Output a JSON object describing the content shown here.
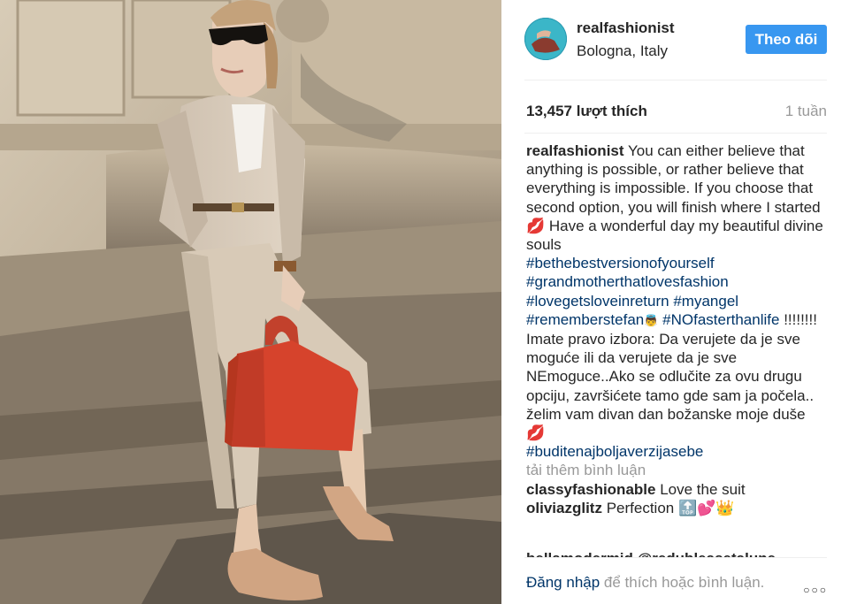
{
  "post": {
    "username": "realfashionist",
    "location": "Bologna, Italy",
    "follow_label": "Theo dõi",
    "likes": "13,457 lượt thích",
    "time": "1 tuần"
  },
  "caption": {
    "username": "realfashionist",
    "text_1": "You can either believe that anything is possible, or rather believe that everything is impossible. If you choose that second option, you will finish where I started 💋 Have a wonderful day my beautiful divine souls",
    "hashtags_1": [
      "#bethebestversionofyourself",
      "#grandmotherthatlovesfashion",
      "#lovegetsloveinreturn",
      "#myangel",
      "#rememberstefan"
    ],
    "emoji_1": "👼",
    "hashtag_2": "#NOfasterthanlife",
    "text_2": "!!!!!!!! Imate pravo izbora: Da verujete da je sve moguće ili da verujete da je sve NEmoguce..Ako se odlučite za ovu drugu opciju, završićete tamo gde sam ja počela.. želim vam divan dan božanske moje duše 💋",
    "hashtag_3": "#buditenajboljaverzijasebe"
  },
  "load_more": "tải thêm bình luận",
  "comments": [
    {
      "user": "classyfashionable",
      "text": "Love the suit"
    },
    {
      "user": "oliviazglitz",
      "text": "Perfection 🔝💕👑"
    }
  ],
  "partial_comment": "bellamodermid @redubleasetalune",
  "footer": {
    "login": "Đăng nhập",
    "rest": "để thích hoặc bình luận.",
    "more": "○○○"
  },
  "colors": {
    "accent": "#3897f0",
    "hashtag": "#003569",
    "muted": "#999999"
  }
}
